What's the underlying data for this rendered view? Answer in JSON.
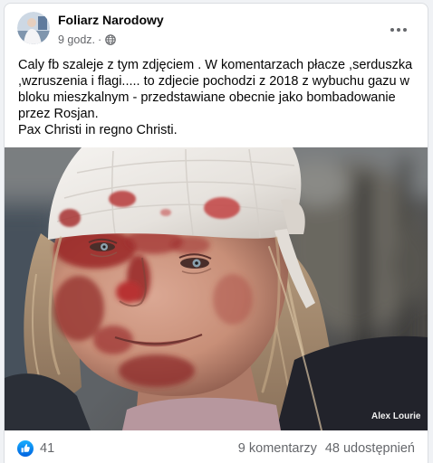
{
  "post": {
    "author": "Foliarz Narodowy",
    "time": "9 godz.",
    "meta_separator": "·",
    "text_lines": [
      "Caly fb szaleje z tym zdjęciem . W komentarzach płacze ,serduszka",
      ",wzruszenia i flagi..... to zdjecie pochodzi z 2018 z wybuchu gazu w",
      "bloku mieszkalnym - przedstawiane obecnie jako bombadowanie",
      "przez Rosjan.",
      "Pax Christi in regno Christi."
    ]
  },
  "photo": {
    "credit": "Alex Lourie"
  },
  "footer": {
    "reaction_count": "41",
    "comments": "9 komentarzy",
    "shares": "48 udostępnień"
  },
  "icons": {
    "privacy": "globe-icon",
    "more": "more-horizontal-icon",
    "reaction": "like-icon"
  },
  "theme": {
    "page_bg": "#f0f2f5",
    "card_bg": "#ffffff",
    "text_primary": "#050505",
    "text_secondary": "#65676b",
    "like_blue": "#1877f2"
  }
}
